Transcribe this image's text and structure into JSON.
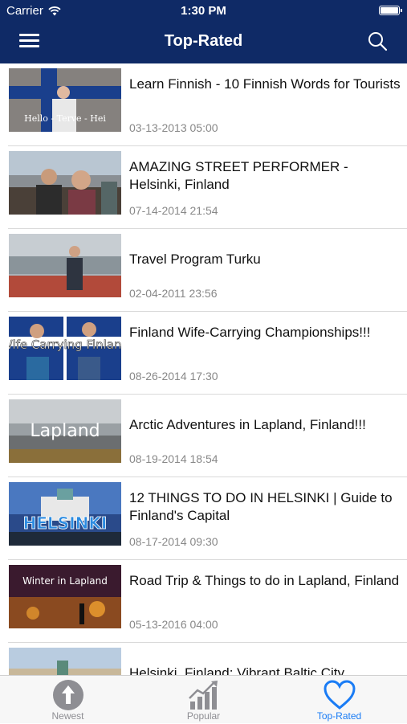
{
  "status": {
    "carrier": "Carrier",
    "time": "1:30 PM"
  },
  "header": {
    "title": "Top-Rated"
  },
  "videos": [
    {
      "title": "Learn Finnish - 10 Finnish Words for Tourists",
      "date": "03-13-2013 05:00",
      "thumb_text": "Hello - Terve - Hei"
    },
    {
      "title": "AMAZING STREET PERFORMER - Helsinki, Finland",
      "date": "07-14-2014 21:54",
      "thumb_text": ""
    },
    {
      "title": "Travel Program Turku",
      "date": "02-04-2011 23:56",
      "thumb_text": ""
    },
    {
      "title": "Finland Wife-Carrying Championships!!!",
      "date": "08-26-2014 17:30",
      "thumb_text": "Wife Carrying Finland"
    },
    {
      "title": "Arctic Adventures in Lapland, Finland!!!",
      "date": "08-19-2014 18:54",
      "thumb_text": "Lapland"
    },
    {
      "title": "12 THINGS TO DO IN HELSINKI | Guide to Finland's Capital",
      "date": "08-17-2014 09:30",
      "thumb_text": "HELSINKI"
    },
    {
      "title": "Road Trip & Things to do in Lapland, Finland",
      "date": "05-13-2016 04:00",
      "thumb_text": "Winter in Lapland"
    },
    {
      "title": "Helsinki, Finland: Vibrant Baltic City",
      "date": "",
      "thumb_text": ""
    }
  ],
  "tabs": [
    {
      "label": "Newest",
      "icon": "arrow-up-circle-icon",
      "active": false
    },
    {
      "label": "Popular",
      "icon": "bar-chart-trend-icon",
      "active": false
    },
    {
      "label": "Top-Rated",
      "icon": "heart-icon",
      "active": true
    }
  ],
  "colors": {
    "navbar": "#0f2a66",
    "tab_active": "#1a7cf5",
    "tab_inactive": "#8e8e93"
  }
}
